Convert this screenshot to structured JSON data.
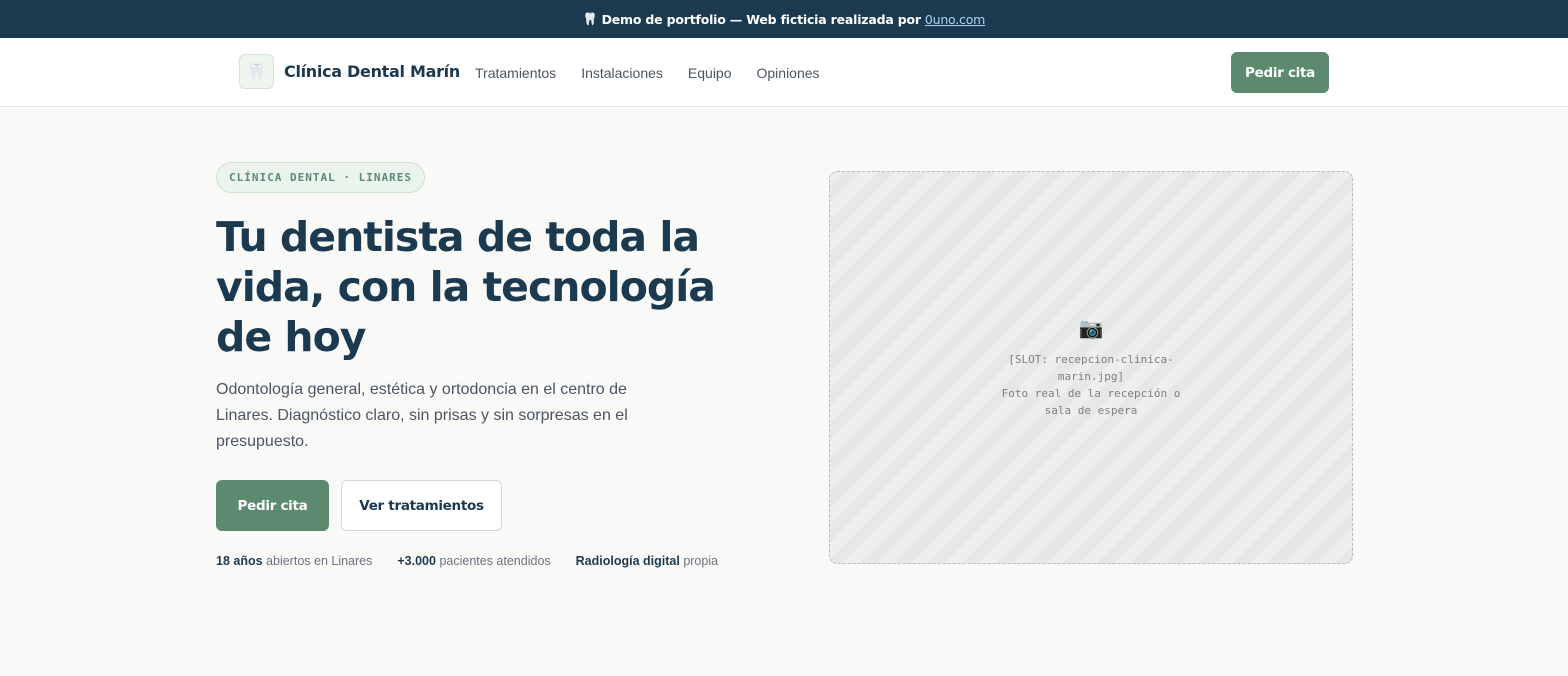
{
  "banner": {
    "icon": "tooth-icon",
    "prefix": "Demo de portfolio — Web ficticia realizada por",
    "link_text": "0uno.com"
  },
  "nav": {
    "logo_icon": "tooth-icon",
    "brand": "Clínica Dental Marín",
    "links": [
      "Tratamientos",
      "Instalaciones",
      "Equipo",
      "Opiniones"
    ],
    "cta": "Pedir cita"
  },
  "hero": {
    "badge": "CLÍNICA DENTAL · LINARES",
    "headline": "Tu dentista de toda la vida, con la tecnología de hoy",
    "subtext": "Odontología general, estética y ortodoncia en el centro de Linares. Diagnóstico claro, sin prisas y sin sorpresas en el presupuesto.",
    "primary_cta": "Pedir cita",
    "secondary_cta": "Ver tratamientos",
    "stats": [
      {
        "strong": "18 años",
        "rest": "abiertos en Linares"
      },
      {
        "strong": "+3.000",
        "rest": "pacientes atendidos"
      },
      {
        "strong": "Radiología digital",
        "rest": "propia"
      }
    ]
  },
  "image_slot": {
    "icon": "camera-icon",
    "line1": "[SLOT: recepcion-clinica-marin.jpg]",
    "line2": "Foto real de la recepción o sala de espera"
  },
  "colors": {
    "navy": "#1c3a4f",
    "accent_green": "#5b8a6e",
    "background": "#f9f9f7"
  }
}
